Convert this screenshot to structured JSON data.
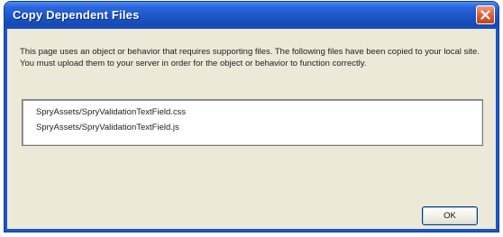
{
  "dialog": {
    "title": "Copy Dependent Files",
    "message": "This page uses an object or behavior that requires supporting files. The following files have been copied to your local site. You must upload them to your server in order for the object or behavior to function correctly.",
    "files": [
      "SpryAssets/SpryValidationTextField.css",
      "SpryAssets/SpryValidationTextField.js"
    ],
    "ok_label": "OK"
  },
  "icons": {
    "close": "close-icon"
  },
  "colors": {
    "titlebar": "#1b55c7",
    "dialog_background": "#ece9d8",
    "close_button": "#d9582d"
  }
}
